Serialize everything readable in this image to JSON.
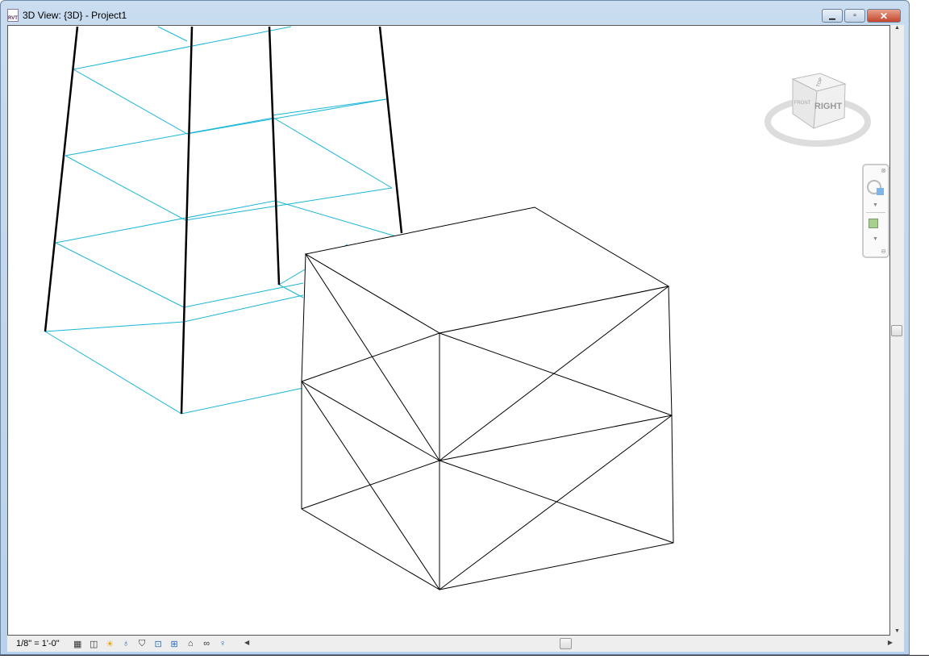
{
  "window": {
    "title": "3D View: {3D} - Project1",
    "app_icon_label": "RVT",
    "buttons": [
      "minimize",
      "maximize",
      "close"
    ]
  },
  "viewcube": {
    "face_front": "FRONT",
    "face_right": "RIGHT",
    "face_top": "TOP"
  },
  "navigation_bar": {
    "tools": [
      "steering-wheel",
      "zoom-region"
    ]
  },
  "status_bar": {
    "scale": "1/8\" = 1'-0\"",
    "icons": [
      "detail-level-icon",
      "visual-style-icon",
      "sun-path-off-icon",
      "shadows-off-icon",
      "crop-view-icon",
      "hide-crop-region-icon",
      "unlock-3d-view-icon",
      "temporary-hide-icon",
      "reveal-hidden-icon",
      "lightbulb-icon"
    ]
  }
}
